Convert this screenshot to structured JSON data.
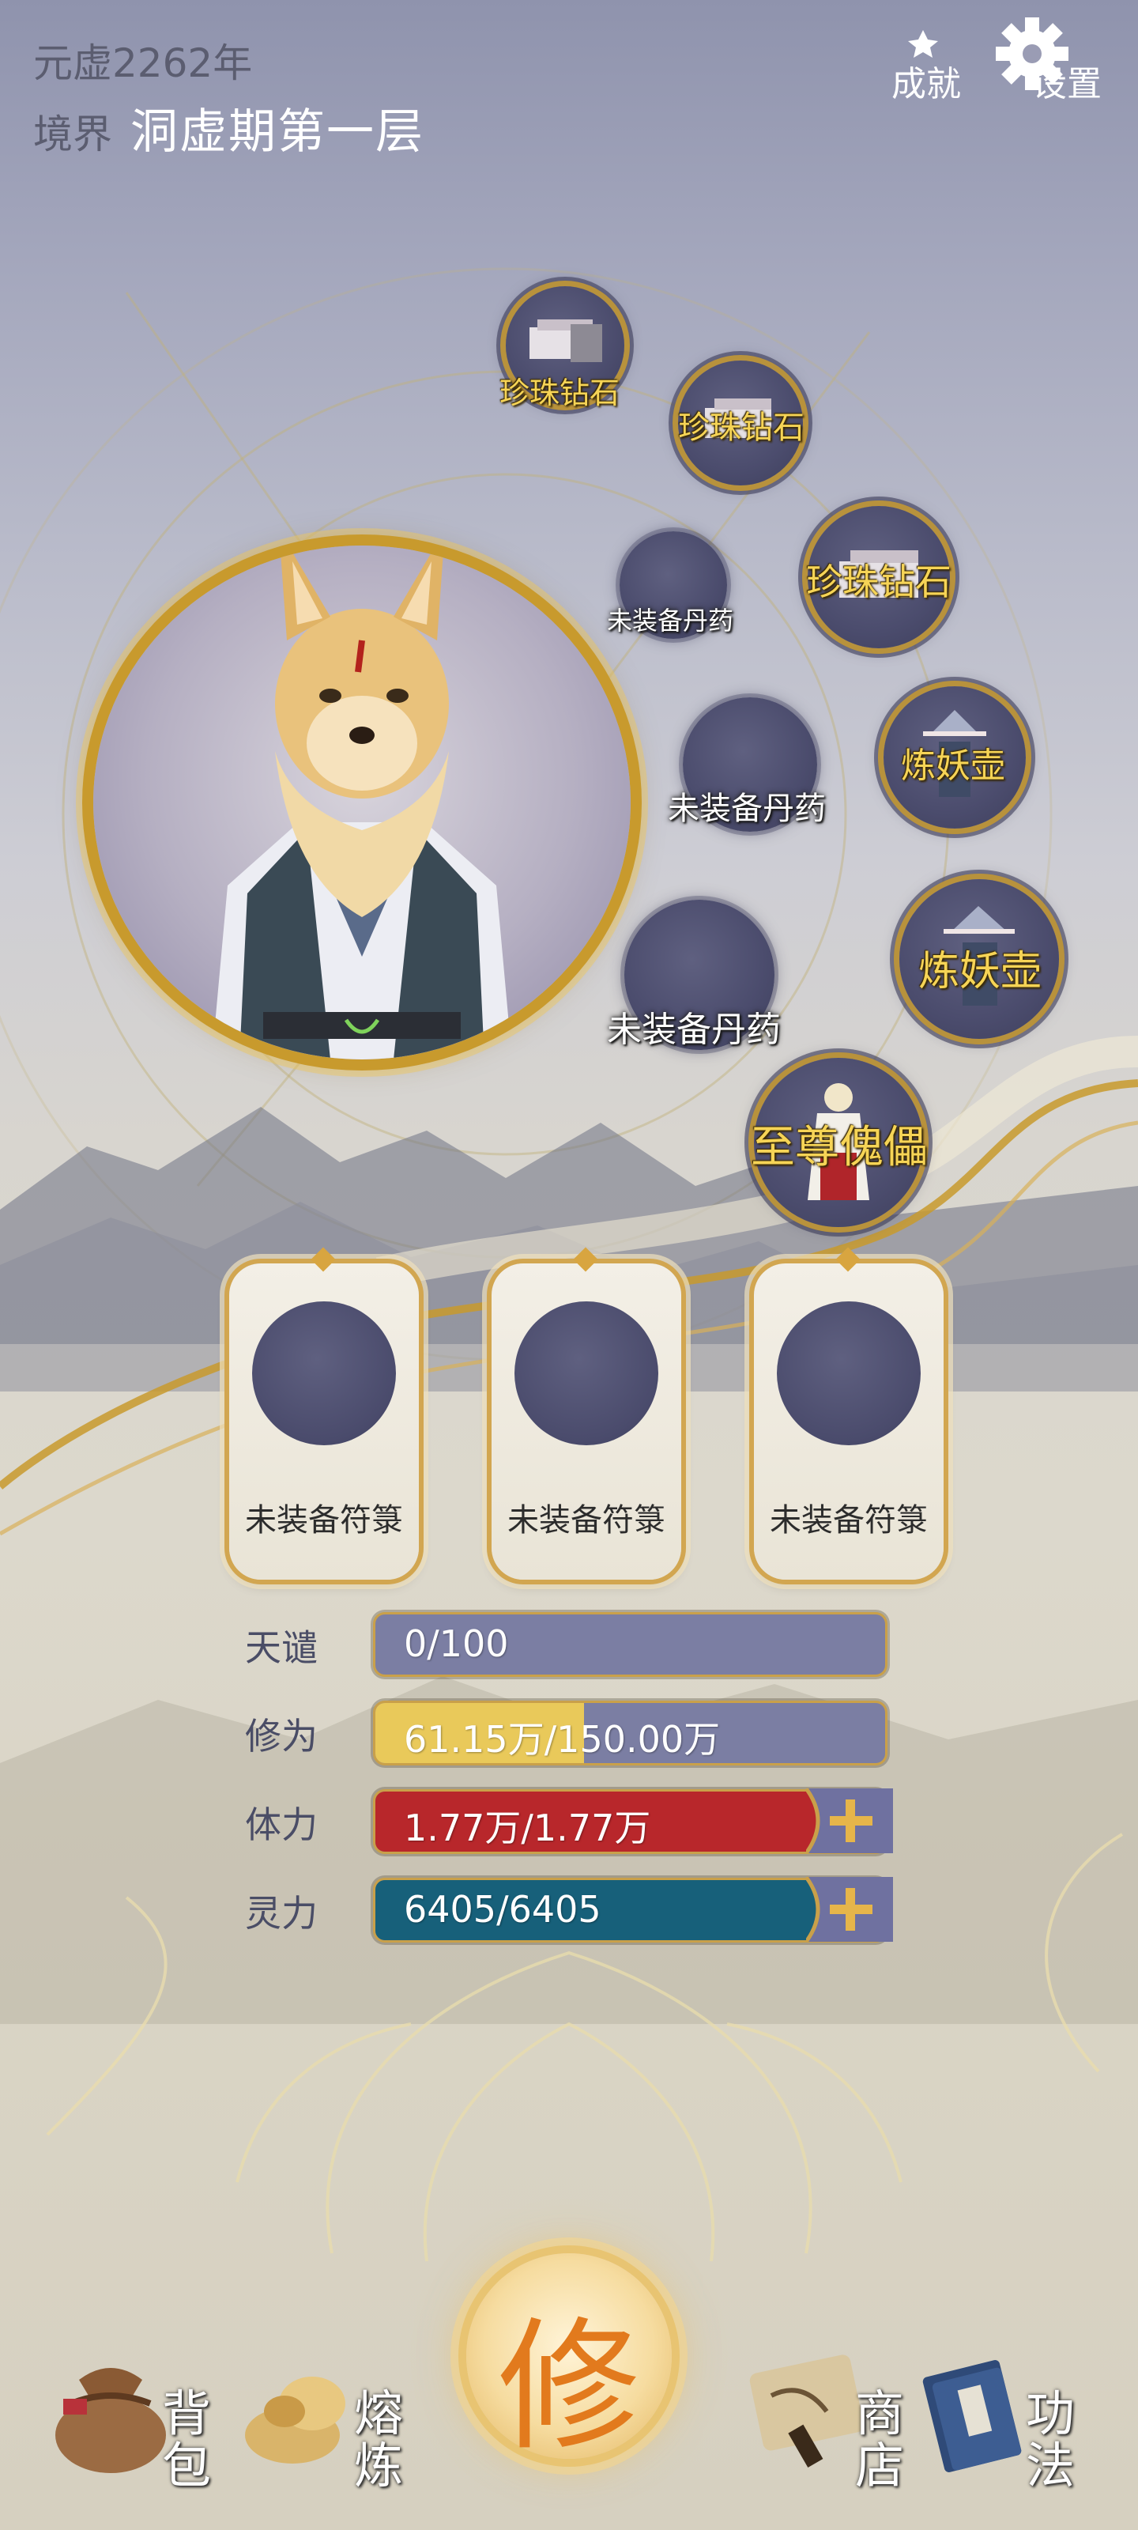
{
  "header": {
    "year": "元虚2262年",
    "realm_label": "境界",
    "realm_value": "洞虚期第一层",
    "achievements_label": "成就",
    "settings_label": "设置"
  },
  "equipment_slots": [
    {
      "label": "珍珠钻石",
      "equipped": true
    },
    {
      "label": "珍珠钻石",
      "equipped": true
    },
    {
      "label": "未装备丹药",
      "equipped": false
    },
    {
      "label": "珍珠钻石",
      "equipped": true
    },
    {
      "label": "未装备丹药",
      "equipped": false
    },
    {
      "label": "炼妖壶",
      "equipped": true
    },
    {
      "label": "未装备丹药",
      "equipped": false
    },
    {
      "label": "炼妖壶",
      "equipped": true
    },
    {
      "label": "至尊傀儡",
      "equipped": true
    }
  ],
  "talismans": [
    {
      "label": "未装备符箓"
    },
    {
      "label": "未装备符箓"
    },
    {
      "label": "未装备符箓"
    }
  ],
  "stats": [
    {
      "label": "天谴",
      "value": "0/100",
      "fill": 0.0,
      "color": "#7b7ea3",
      "has_plus": false
    },
    {
      "label": "修为",
      "value": "61.15万/150.00万",
      "fill": 0.41,
      "color": "#e9c95a",
      "has_plus": false
    },
    {
      "label": "体力",
      "value": "1.77万/1.77万",
      "fill": 1.0,
      "color": "#b8272b",
      "has_plus": true
    },
    {
      "label": "灵力",
      "value": "6405/6405",
      "fill": 1.0,
      "color": "#17607a",
      "has_plus": true
    }
  ],
  "bottom_nav": {
    "bag": "背包",
    "smelt": "熔炼",
    "cultivate": "修",
    "shop": "商店",
    "skills": "功法"
  },
  "colors": {
    "gold": "#c99a3a",
    "slot": "#4b4c6d",
    "bar_base": "#7b7ea3"
  }
}
